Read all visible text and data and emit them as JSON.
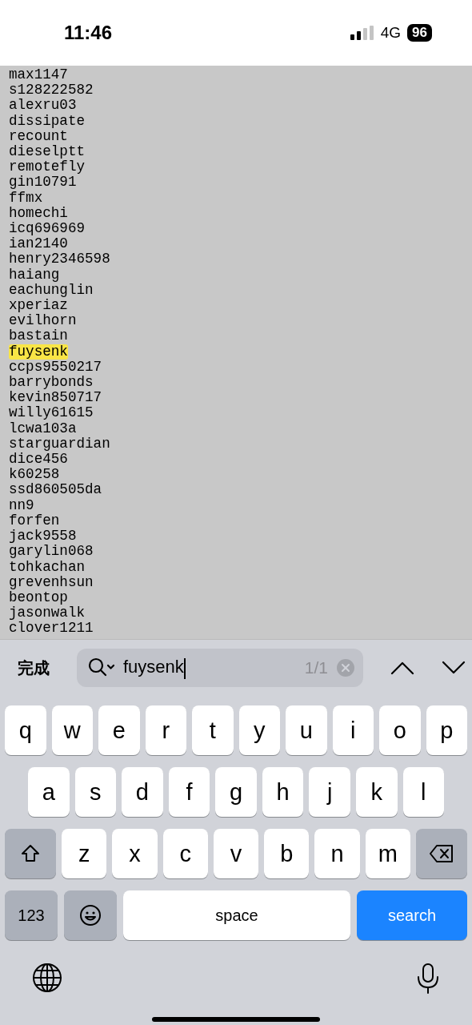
{
  "status_bar": {
    "time": "11:46",
    "network": "4G",
    "battery": "96"
  },
  "list": [
    {
      "text": "max1147",
      "highlighted": false
    },
    {
      "text": "s128222582",
      "highlighted": false
    },
    {
      "text": "alexru03",
      "highlighted": false
    },
    {
      "text": "dissipate",
      "highlighted": false
    },
    {
      "text": "recount",
      "highlighted": false
    },
    {
      "text": "dieselptt",
      "highlighted": false
    },
    {
      "text": "remotefly",
      "highlighted": false
    },
    {
      "text": "gin10791",
      "highlighted": false
    },
    {
      "text": "ffmx",
      "highlighted": false
    },
    {
      "text": "homechi",
      "highlighted": false
    },
    {
      "text": "icq696969",
      "highlighted": false
    },
    {
      "text": "ian2140",
      "highlighted": false
    },
    {
      "text": "henry2346598",
      "highlighted": false
    },
    {
      "text": "haiang",
      "highlighted": false
    },
    {
      "text": "eachunglin",
      "highlighted": false
    },
    {
      "text": "xperiaz",
      "highlighted": false
    },
    {
      "text": "evilhorn",
      "highlighted": false
    },
    {
      "text": "bastain",
      "highlighted": false
    },
    {
      "text": "fuysenk",
      "highlighted": true
    },
    {
      "text": "ccps9550217",
      "highlighted": false
    },
    {
      "text": "barrybonds",
      "highlighted": false
    },
    {
      "text": "kevin850717",
      "highlighted": false
    },
    {
      "text": "willy61615",
      "highlighted": false
    },
    {
      "text": "lcwa103a",
      "highlighted": false
    },
    {
      "text": "starguardian",
      "highlighted": false
    },
    {
      "text": "dice456",
      "highlighted": false
    },
    {
      "text": "k60258",
      "highlighted": false
    },
    {
      "text": "ssd860505da",
      "highlighted": false
    },
    {
      "text": "nn9",
      "highlighted": false
    },
    {
      "text": "forfen",
      "highlighted": false
    },
    {
      "text": "jack9558",
      "highlighted": false
    },
    {
      "text": "garylin068",
      "highlighted": false
    },
    {
      "text": "tohkachan",
      "highlighted": false
    },
    {
      "text": "grevenhsun",
      "highlighted": false
    },
    {
      "text": "beontop",
      "highlighted": false
    },
    {
      "text": "jasonwalk",
      "highlighted": false
    },
    {
      "text": "clover1211",
      "highlighted": false
    }
  ],
  "find_bar": {
    "done": "完成",
    "query": "fuysenk",
    "count": "1/1"
  },
  "keyboard": [
    [
      {
        "kind": "letter",
        "label": "q"
      },
      {
        "kind": "letter",
        "label": "w"
      },
      {
        "kind": "letter",
        "label": "e"
      },
      {
        "kind": "letter",
        "label": "r"
      },
      {
        "kind": "letter",
        "label": "t"
      },
      {
        "kind": "letter",
        "label": "y"
      },
      {
        "kind": "letter",
        "label": "u"
      },
      {
        "kind": "letter",
        "label": "i"
      },
      {
        "kind": "letter",
        "label": "o"
      },
      {
        "kind": "letter",
        "label": "p"
      }
    ],
    [
      {
        "kind": "letter",
        "label": "a"
      },
      {
        "kind": "letter",
        "label": "s"
      },
      {
        "kind": "letter",
        "label": "d"
      },
      {
        "kind": "letter",
        "label": "f"
      },
      {
        "kind": "letter",
        "label": "g"
      },
      {
        "kind": "letter",
        "label": "h"
      },
      {
        "kind": "letter",
        "label": "j"
      },
      {
        "kind": "letter",
        "label": "k"
      },
      {
        "kind": "letter",
        "label": "l"
      }
    ],
    [
      {
        "kind": "shift"
      },
      {
        "kind": "letter",
        "label": "z"
      },
      {
        "kind": "letter",
        "label": "x"
      },
      {
        "kind": "letter",
        "label": "c"
      },
      {
        "kind": "letter",
        "label": "v"
      },
      {
        "kind": "letter",
        "label": "b"
      },
      {
        "kind": "letter",
        "label": "n"
      },
      {
        "kind": "letter",
        "label": "m"
      },
      {
        "kind": "backspace"
      }
    ],
    [
      {
        "kind": "numbers",
        "label": "123"
      },
      {
        "kind": "emoji"
      },
      {
        "kind": "space",
        "label": "space"
      },
      {
        "kind": "action",
        "label": "search"
      }
    ]
  ]
}
